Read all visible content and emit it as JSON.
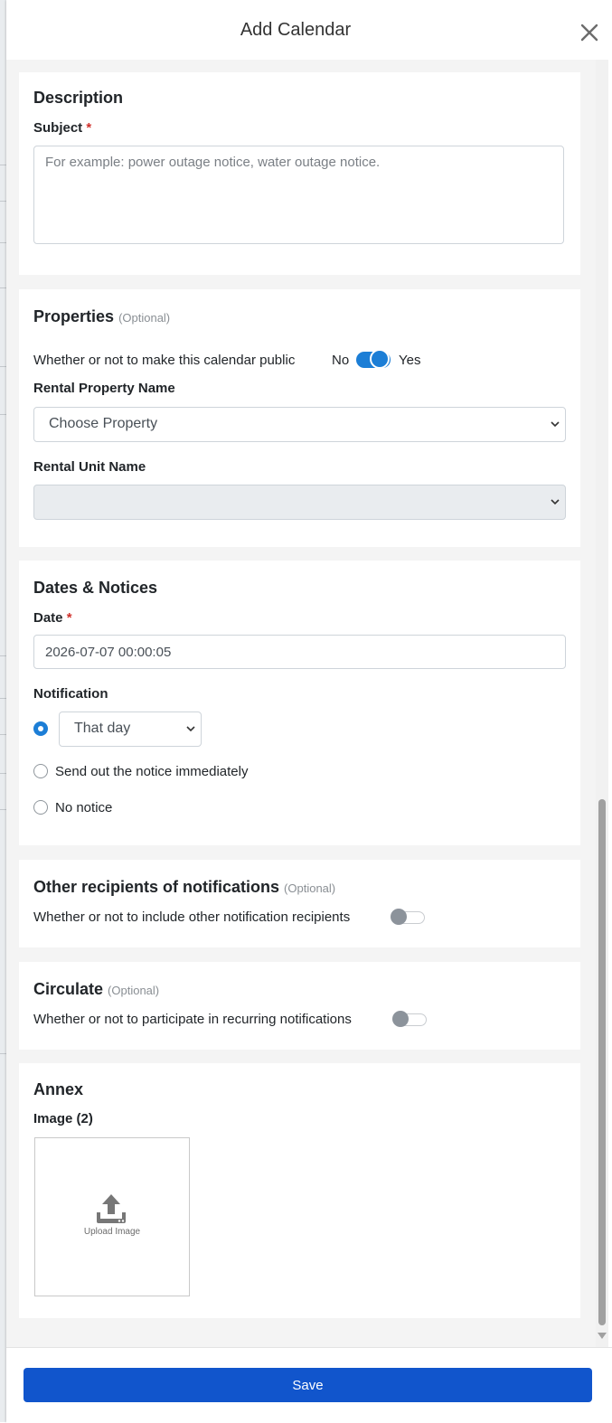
{
  "modal": {
    "title": "Add Calendar",
    "close_icon": "close-icon"
  },
  "description": {
    "heading": "Description",
    "subject_label": "Subject",
    "required_mark": "*",
    "subject_placeholder": "For example: power outage notice, water outage notice.",
    "subject_value": ""
  },
  "properties": {
    "heading": "Properties",
    "optional": "(Optional)",
    "public_question": "Whether or not to make this calendar public",
    "public_no": "No",
    "public_yes": "Yes",
    "public_on": true,
    "property_label": "Rental Property Name",
    "property_selected": "Choose Property",
    "unit_label": "Rental Unit Name",
    "unit_selected": ""
  },
  "dates": {
    "heading": "Dates & Notices",
    "date_label": "Date",
    "required_mark": "*",
    "date_value": "2026-07-07 00:00:05",
    "notification_label": "Notification",
    "notification_timing_selected": "That day",
    "option_immediately": "Send out the notice immediately",
    "option_none": "No notice",
    "selected_option": "timed"
  },
  "other_recipients": {
    "heading": "Other recipients of notifications",
    "optional": "(Optional)",
    "question": "Whether or not to include other notification recipients",
    "enabled": false
  },
  "circulate": {
    "heading": "Circulate",
    "optional": "(Optional)",
    "question": "Whether or not to participate in recurring notifications",
    "enabled": false
  },
  "annex": {
    "heading": "Annex",
    "image_label": "Image (2)",
    "upload_label": "Upload Image",
    "upload_icon": "upload-icon"
  },
  "footer": {
    "save_label": "Save"
  },
  "colors": {
    "accent": "#1c7ed6",
    "save_button": "#1155cc",
    "required": "#d0302b",
    "panel_bg": "#f4f4f4"
  }
}
